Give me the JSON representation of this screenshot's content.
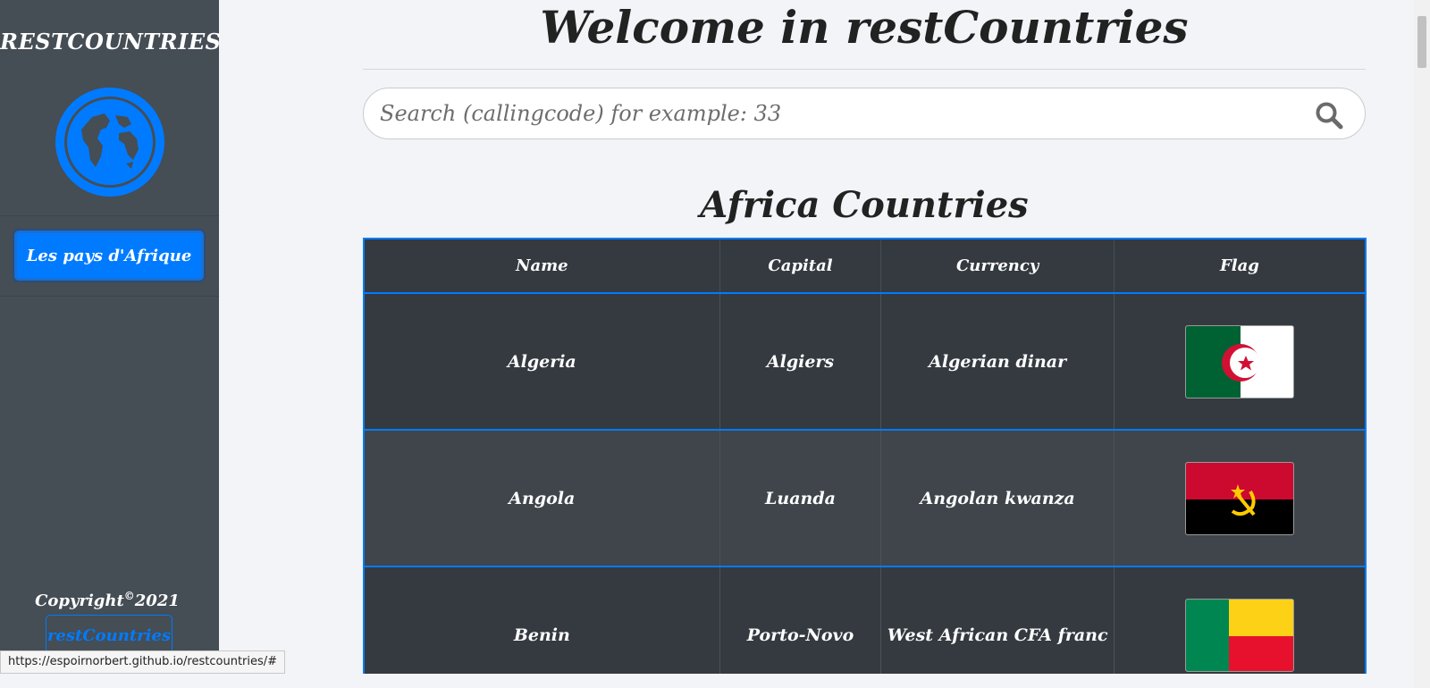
{
  "sidebar": {
    "brand": "RESTCOUNTRIES",
    "logo_icon": "globe-americas-icon",
    "nav_button": "Les pays d'Afrique",
    "copyright_text": "Copyright",
    "copyright_symbol": "©",
    "copyright_year": "2021",
    "footer_button": "restCountries"
  },
  "main": {
    "title": "Welcome in restCountries",
    "search": {
      "placeholder": "Search (callingcode) for example: 33",
      "icon": "search-icon"
    },
    "section_title": "Africa Countries",
    "table": {
      "headers": [
        "Name",
        "Capital",
        "Currency",
        "Flag"
      ],
      "rows": [
        {
          "name": "Algeria",
          "capital": "Algiers",
          "currency": "Algerian dinar",
          "flag": "algeria-flag"
        },
        {
          "name": "Angola",
          "capital": "Luanda",
          "currency": "Angolan kwanza",
          "flag": "angola-flag"
        },
        {
          "name": "Benin",
          "capital": "Porto-Novo",
          "currency": "West African CFA franc",
          "flag": "benin-flag"
        }
      ]
    }
  },
  "status_bar": {
    "url": "https://espoirnorbert.github.io/restcountries/#"
  },
  "colors": {
    "sidebar_bg": "#454d55",
    "accent": "#007bff",
    "table_dark": "#343a40",
    "page_bg": "#f3f4f8"
  }
}
